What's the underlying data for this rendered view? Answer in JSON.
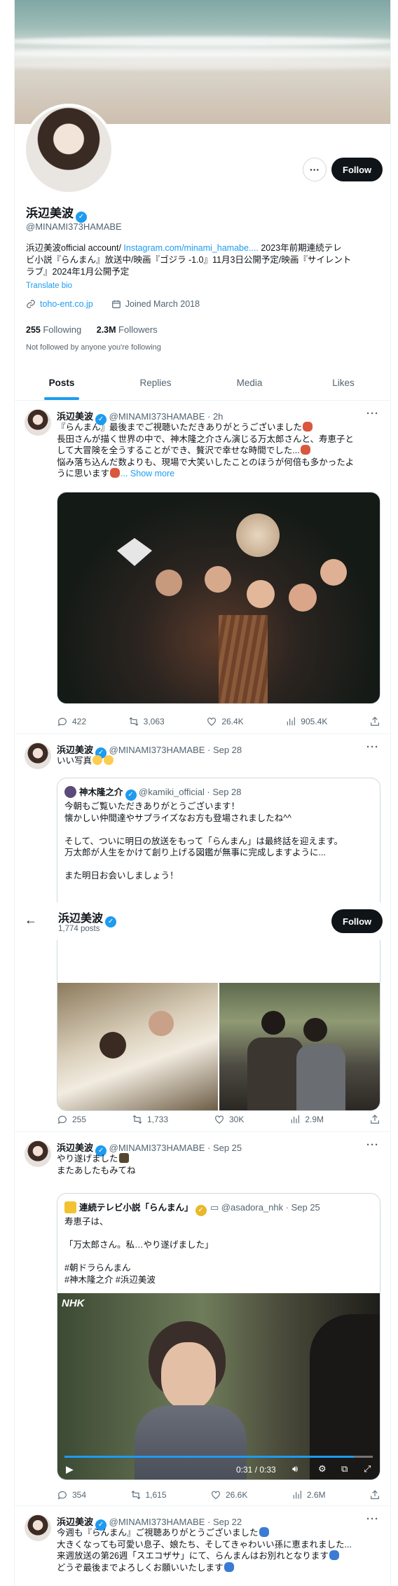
{
  "profile": {
    "name": "浜辺美波",
    "handle": "@MINAMI373HAMABE",
    "bio_prefix": "浜辺美波official account/ ",
    "bio_link": "Instagram.com/minami_hamabe....",
    "bio_line1_rest": " 2023年前期連続テレ",
    "bio_line2": "ビ小説『らんまん』放送中/映画『ゴジラ -1.0』11月3日公開予定/映画『サイレント",
    "bio_line3": "ラブ』2024年1月公開予定",
    "translate": "Translate bio",
    "website": "toho-ent.co.jp",
    "joined": "Joined March 2018",
    "following_count": "255",
    "following_label": "Following",
    "followers_count": "2.3M",
    "followers_label": "Followers",
    "not_followed": "Not followed by anyone you're following",
    "follow_label": "Follow",
    "more_label": "···"
  },
  "tabs": [
    "Posts",
    "Replies",
    "Media",
    "Likes"
  ],
  "sticky_header": {
    "name": "浜辺美波",
    "posts_count": "1,774 posts",
    "follow_label": "Follow",
    "back_icon": "arrow-left-icon"
  },
  "tweets": [
    {
      "name": "浜辺美波",
      "handle": "@MINAMI373HAMABE",
      "time": "· 2h",
      "lines": [
        "『らんまん』最後までご視聴いただきありがとうございました",
        "長田さんが描く世界の中で、神木隆之介さん演じる万太郎さんと、寿恵子と",
        "して大冒険を全うすることができ、贅沢で幸せな時間でした...",
        "悩み落ち込んだ数よりも、現場で大笑いしたことのほうが何倍も多かったよ",
        "うに思います"
      ],
      "show_more": "... Show more",
      "replies": "422",
      "reposts": "3,063",
      "likes": "26.4K",
      "views": "905.4K"
    },
    {
      "name": "浜辺美波",
      "handle": "@MINAMI373HAMABE",
      "time": "· Sep 28",
      "text": "いい写真",
      "quote": {
        "name": "神木隆之介",
        "handle": "@kamiki_official",
        "time": "· Sep 28",
        "lines": [
          "今朝もご覧いただきありがとうございます！",
          "懐かしい仲間達やサプライズなお方も登場されましたね^^",
          "",
          "そして、ついに明日の放送をもって「らんまん」は最終話を迎えます。",
          "万太郎が人生をかけて創り上げる図鑑が無事に完成しますように...",
          "",
          "また明日お会いしましょう！"
        ]
      },
      "replies": "255",
      "reposts": "1,733",
      "likes": "30K",
      "views": "2.9M"
    },
    {
      "name": "浜辺美波",
      "handle": "@MINAMI373HAMABE",
      "time": "· Sep 25",
      "lines": [
        "やり遂げました",
        "またあしたもみてね"
      ],
      "quote": {
        "name": "連続テレビ小説「らんまん」",
        "handle": "@asadora_nhk",
        "time": "· Sep 25",
        "lines": [
          "寿恵子は、",
          "",
          "「万太郎さん。私…やり遂げました」",
          "",
          "#朝ドラらんまん",
          "#神木隆之介 #浜辺美波"
        ],
        "video_logo": "NHK",
        "video_time": "0:31 / 0:33"
      },
      "replies": "354",
      "reposts": "1,615",
      "likes": "26.6K",
      "views": "2.6M"
    },
    {
      "name": "浜辺美波",
      "handle": "@MINAMI373HAMABE",
      "time": "· Sep 22",
      "lines": [
        "今週も『らんまん』ご視聴ありがとうございました",
        "大きくなっても可愛い息子、娘たち、そしてきゃわいい孫に恵まれました...",
        "来週放送の第26週「スエコザサ」にて、らんまんはお別れとなります",
        "どうぞ最後までよろしくお願いいたします"
      ]
    }
  ],
  "icons": {
    "verified": "verified-badge-icon",
    "link": "link-icon",
    "calendar": "calendar-icon",
    "reply": "reply-icon",
    "repost": "repost-icon",
    "like": "heart-icon",
    "views": "views-chart-icon",
    "share": "share-icon"
  },
  "colors": {
    "accent": "#1d9bf0",
    "text": "#0f1419",
    "muted": "#536471"
  }
}
